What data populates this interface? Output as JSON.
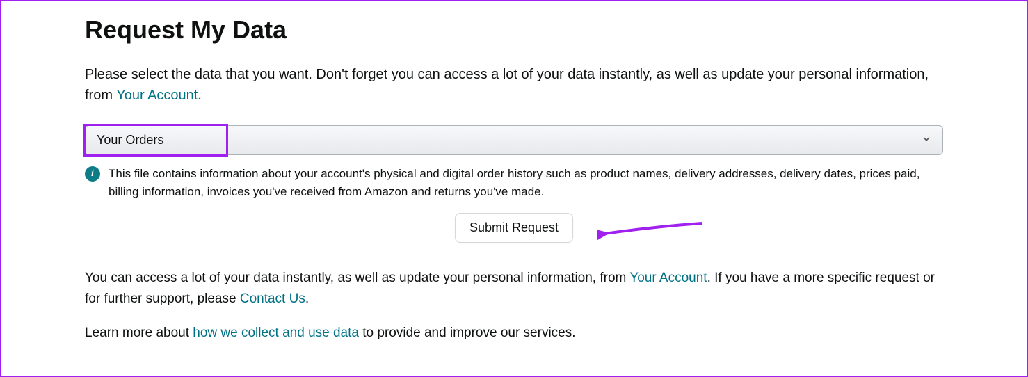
{
  "heading": "Request My Data",
  "intro": {
    "part1": "Please select the data that you want. Don't forget you can access a lot of your data instantly, as well as update your personal information, from ",
    "link": "Your Account",
    "part2": "."
  },
  "dropdown": {
    "selected": "Your Orders"
  },
  "info": {
    "text": "This file contains information about your account's physical and digital order history such as product names, delivery addresses, delivery dates, prices paid, billing information, invoices you've received from Amazon and returns you've made."
  },
  "submit_label": "Submit Request",
  "footer1": {
    "part1": "You can access a lot of your data instantly, as well as update your personal information, from ",
    "link1": "Your Account",
    "part2": ". If you have a more specific request or for further support, please ",
    "link2": "Contact Us",
    "part3": "."
  },
  "footer2": {
    "part1": "Learn more about ",
    "link": "how we collect and use data",
    "part2": " to provide and improve our services."
  },
  "colors": {
    "highlight": "#a020f0",
    "link": "#007185",
    "info_icon": "#0e7c86"
  }
}
